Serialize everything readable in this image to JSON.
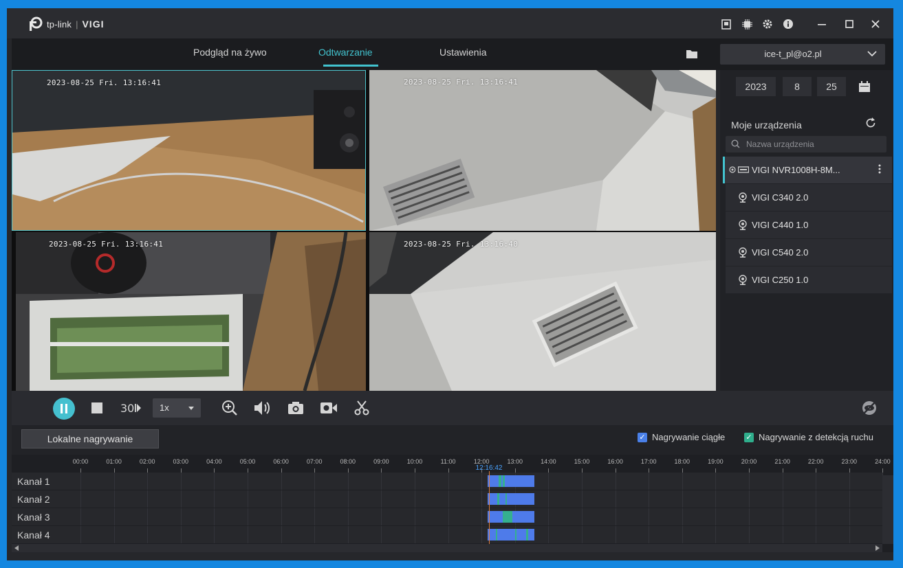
{
  "app": {
    "brand": "tp-link",
    "product": "VIGI"
  },
  "nav": {
    "tabs": [
      {
        "label": "Podgląd na żywo",
        "active": false
      },
      {
        "label": "Odtwarzanie",
        "active": true
      },
      {
        "label": "Ustawienia",
        "active": false
      }
    ],
    "account": "ice-t_pl@o2.pl"
  },
  "cameras": [
    {
      "timestamp": "2023-08-25 Fri. 13:16:41"
    },
    {
      "timestamp": "2023-08-25 Fri. 13:16:41"
    },
    {
      "timestamp": "2023-08-25 Fri. 13:16:41"
    },
    {
      "timestamp": "2023-08-25 Fri. 13:16:40"
    }
  ],
  "sidebar": {
    "date": {
      "year": "2023",
      "month": "8",
      "day": "25"
    },
    "title": "Moje urządzenia",
    "search_placeholder": "Nazwa urządzenia",
    "devices": [
      {
        "label": "VIGI NVR1008H-8M...",
        "type": "nvr",
        "selected": true
      },
      {
        "label": "VIGI C340 2.0",
        "type": "camera"
      },
      {
        "label": "VIGI C440 1.0",
        "type": "camera"
      },
      {
        "label": "VIGI C540 2.0",
        "type": "camera"
      },
      {
        "label": "VIGI C250 1.0",
        "type": "camera"
      }
    ]
  },
  "controls": {
    "speed": "1x",
    "icons": [
      "pause-icon",
      "stop-icon",
      "frame-step-icon",
      "zoom-icon",
      "volume-icon",
      "snapshot-icon",
      "record-icon",
      "clip-icon",
      "hide-icon"
    ]
  },
  "toolbar2": {
    "local_recording": "Lokalne nagrywanie",
    "continuous_label": "Nagrywanie ciągłe",
    "motion_label": "Nagrywanie z detekcją ruchu"
  },
  "timeline": {
    "hours": [
      "00:00",
      "01:00",
      "02:00",
      "03:00",
      "04:00",
      "05:00",
      "06:00",
      "07:00",
      "08:00",
      "09:00",
      "10:00",
      "11:00",
      "12:00",
      "13:00",
      "14:00",
      "15:00",
      "16:00",
      "17:00",
      "18:00",
      "19:00",
      "20:00",
      "21:00",
      "22:00",
      "23:00",
      "24:00"
    ],
    "current_time": "12:16:42",
    "channels": [
      "Kanał 1",
      "Kanał 2",
      "Kanał 3",
      "Kanał 4"
    ],
    "colors": {
      "continuous": "#4e7bea",
      "motion": "#35b08f",
      "accent": "#42c3cf"
    }
  }
}
